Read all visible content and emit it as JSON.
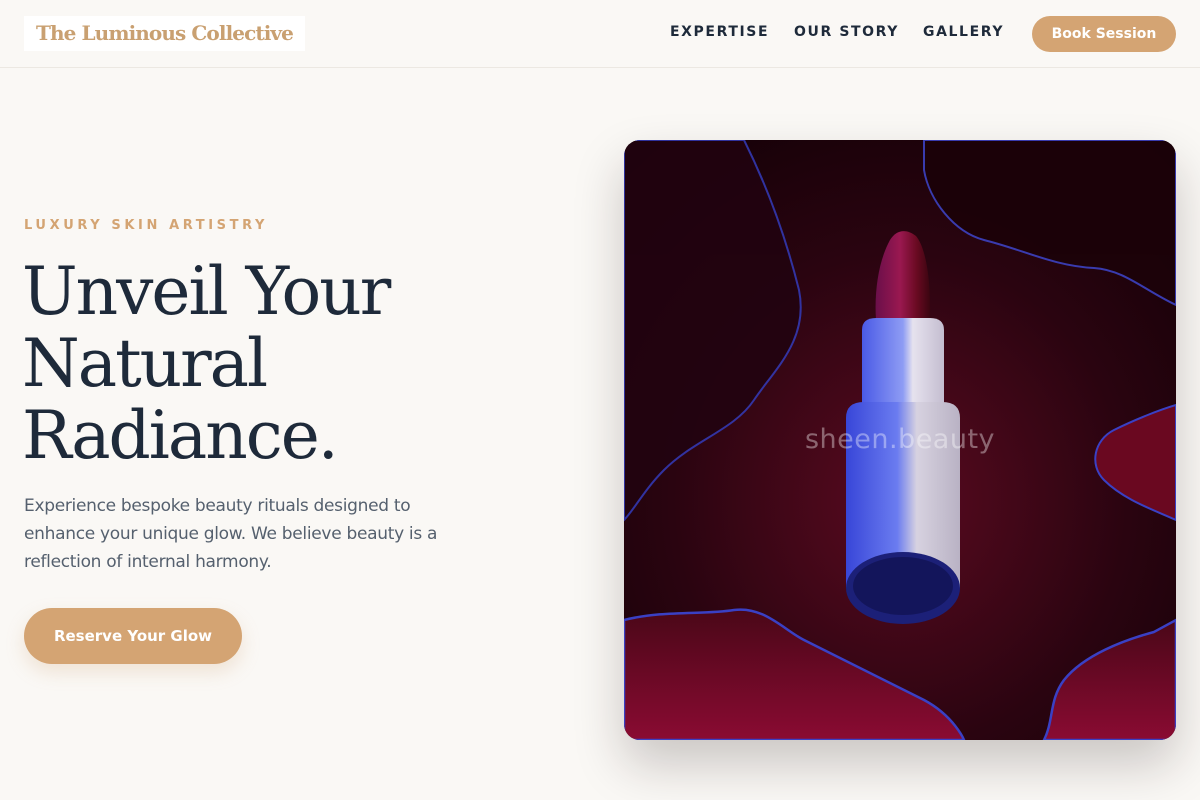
{
  "header": {
    "logo": "The Luminous Collective",
    "nav": [
      "EXPERTISE",
      "OUR STORY",
      "GALLERY"
    ],
    "cta_label": "Book Session"
  },
  "hero": {
    "eyebrow": "LUXURY SKIN ARTISTRY",
    "headline_lines": [
      "Unveil Your",
      "Natural",
      "Radiance."
    ],
    "intro": "Experience bespoke beauty rituals designed to enhance your unique glow. We believe beauty is a reflection of internal harmony.",
    "cta_label": "Reserve Your Glow",
    "image": {
      "subject": "lipstick-on-crimson-liquid",
      "watermark": "sheen.beauty"
    }
  },
  "colors": {
    "background": "#faf8f5",
    "accent": "#d4a473",
    "text_dark": "#1e2a3a",
    "text_muted": "#55606e"
  }
}
